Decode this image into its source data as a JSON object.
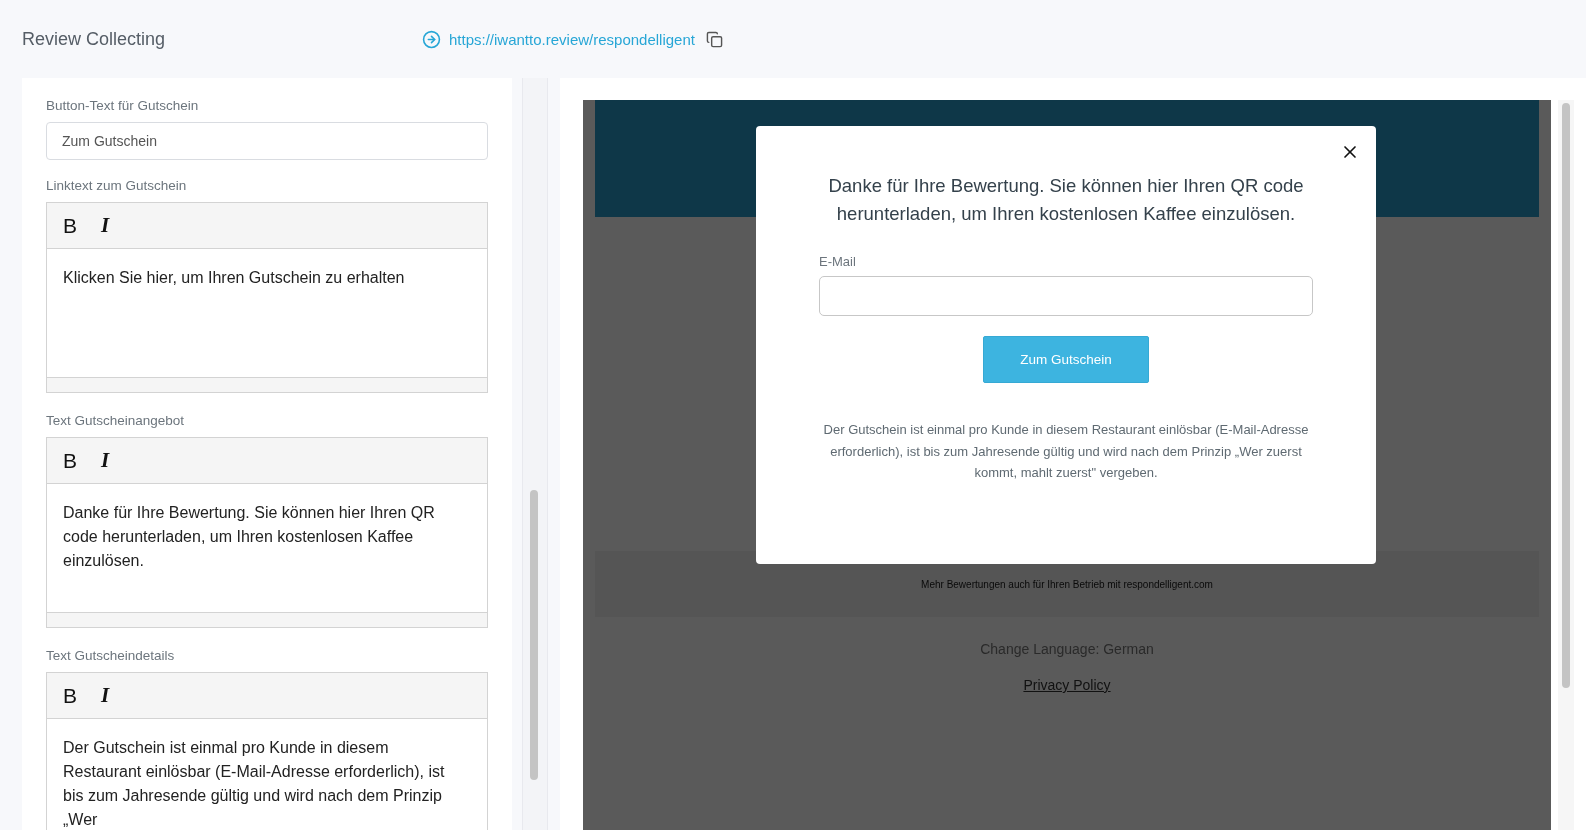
{
  "header": {
    "title": "Review Collecting",
    "url": "https://iwantto.review/respondelligent"
  },
  "form": {
    "fields": [
      {
        "kind": "input",
        "label": "Button-Text für Gutschein",
        "value": "Zum Gutschein"
      },
      {
        "kind": "editor",
        "label": "Linktext zum Gutschein",
        "bold_label": "B",
        "italic_label": "I",
        "text": "Klicken Sie hier, um Ihren Gutschein zu erhalten"
      },
      {
        "kind": "editor",
        "label": "Text Gutscheinangebot",
        "bold_label": "B",
        "italic_label": "I",
        "text": "Danke für Ihre Bewertung. Sie können hier Ihren QR code herunterladen, um Ihren kostenlosen Kaffee einzulösen."
      },
      {
        "kind": "editor",
        "label": "Text Gutscheindetails",
        "bold_label": "B",
        "italic_label": "I",
        "text": "Der Gutschein ist einmal pro Kunde in diesem Restaurant einlösbar (E-Mail-Adresse erforderlich), ist bis zum Jahresende gültig und wird nach dem Prinzip „Wer"
      }
    ]
  },
  "preview": {
    "footer_note": "Mehr Bewertungen auch für Ihren Betrieb mit respondelligent.com",
    "language": "Change Language: German",
    "privacy": "Privacy Policy",
    "modal": {
      "heading": "Danke für Ihre Bewertung. Sie können hier Ihren QR code herunterladen, um Ihren kostenlosen Kaffee einzulösen.",
      "email_label": "E-Mail",
      "button": "Zum Gutschein",
      "details": "Der Gutschein ist einmal pro Kunde in diesem Restaurant einlösbar (E-Mail-Adresse erforderlich), ist bis zum Jahresende gültig und wird nach dem Prinzip „Wer zuerst kommt, mahlt zuerst\" vergeben."
    }
  }
}
